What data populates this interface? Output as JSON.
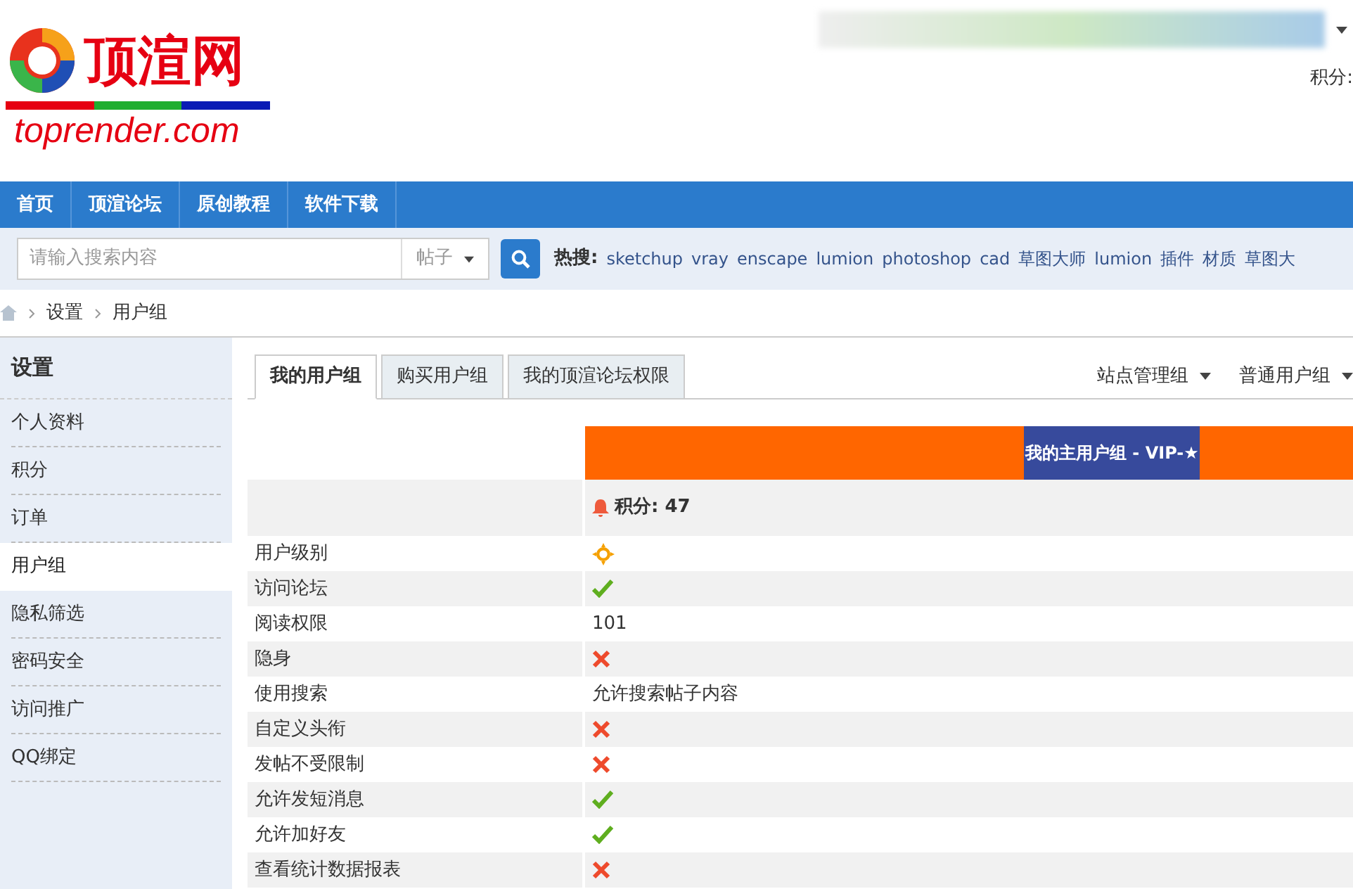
{
  "header": {
    "logo_title": "顶渲网",
    "logo_domain": "toprender.com",
    "points_label": "积分:"
  },
  "nav": [
    {
      "label": "首页"
    },
    {
      "label": "顶渲论坛"
    },
    {
      "label": "原创教程"
    },
    {
      "label": "软件下载"
    }
  ],
  "search": {
    "placeholder": "请输入搜索内容",
    "scope": "帖子",
    "hot_label": "热搜:",
    "hot": [
      "sketchup",
      "vray",
      "enscape",
      "lumion",
      "photoshop",
      "cad",
      "草图大师",
      "lumion",
      "插件",
      "材质",
      "草图大"
    ]
  },
  "breadcrumb": [
    "设置",
    "用户组"
  ],
  "sidebar": {
    "title": "设置",
    "items": [
      {
        "label": "个人资料",
        "selected": false
      },
      {
        "label": "积分",
        "selected": false
      },
      {
        "label": "订单",
        "selected": false
      },
      {
        "label": "用户组",
        "selected": true
      },
      {
        "label": "隐私筛选",
        "selected": false
      },
      {
        "label": "密码安全",
        "selected": false
      },
      {
        "label": "访问推广",
        "selected": false
      },
      {
        "label": "QQ绑定",
        "selected": false
      }
    ]
  },
  "tabs": [
    {
      "label": "我的用户组",
      "selected": true
    },
    {
      "label": "购买用户组",
      "selected": false
    },
    {
      "label": "我的顶渲论坛权限",
      "selected": false
    }
  ],
  "group_menus": [
    {
      "label": "站点管理组"
    },
    {
      "label": "普通用户组"
    }
  ],
  "table": {
    "group_title": "我的主用户组 - VIP-★",
    "points": "积分: 47",
    "rows": [
      {
        "label": "用户级别",
        "kind": "sun"
      },
      {
        "label": "访问论坛",
        "kind": "yes"
      },
      {
        "label": "阅读权限",
        "kind": "text",
        "value": "101"
      },
      {
        "label": "隐身",
        "kind": "no"
      },
      {
        "label": "使用搜索",
        "kind": "text",
        "value": "允许搜索帖子内容"
      },
      {
        "label": "自定义头衔",
        "kind": "no"
      },
      {
        "label": "发帖不受限制",
        "kind": "no"
      },
      {
        "label": "允许发短消息",
        "kind": "yes"
      },
      {
        "label": "允许加好友",
        "kind": "yes"
      },
      {
        "label": "查看统计数据报表",
        "kind": "no"
      }
    ]
  }
}
